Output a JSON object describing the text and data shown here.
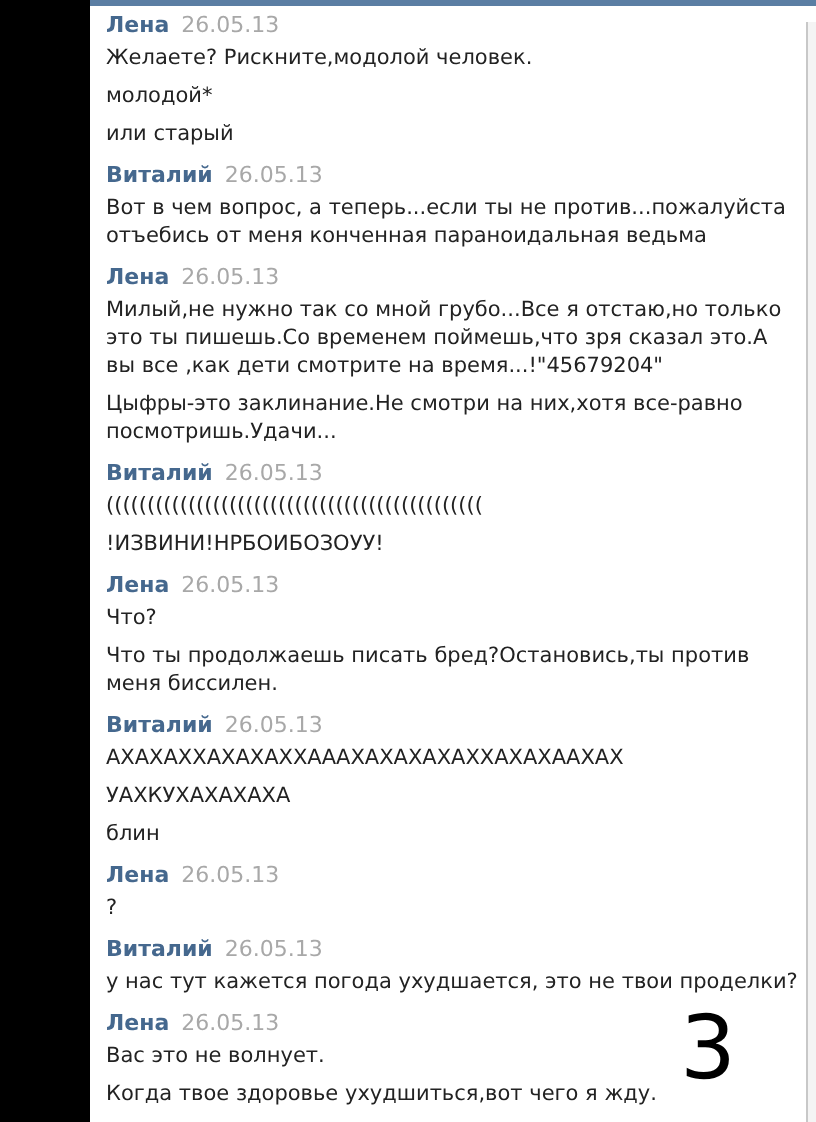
{
  "messages": [
    {
      "author": "Лена",
      "date": "26.05.13",
      "lines": [
        "Желаете? Рискните,модолой человек.",
        "молодой*",
        "или старый"
      ]
    },
    {
      "author": "Виталий",
      "date": "26.05.13",
      "lines": [
        "Вот в чем вопрос, а теперь...если ты не против...пожалуйста отъебись от меня конченная параноидальная ведьма"
      ]
    },
    {
      "author": "Лена",
      "date": "26.05.13",
      "lines": [
        "Милый,не нужно так со мной грубо...Все я отстаю,но только это ты пишешь.Со временем поймешь,что зря сказал это.А вы все ,как дети смотрите на время...!\"45679204\"",
        "Цыфры-это заклинание.Не смотри на них,хотя все-равно посмотришь.Удачи..."
      ]
    },
    {
      "author": "Виталий",
      "date": "26.05.13",
      "lines": [
        "((((((((((((((((((((((((((((((((((((((((((((((",
        "!ИЗВИНИ!НРБОИБОЗОУУ!"
      ]
    },
    {
      "author": "Лена",
      "date": "26.05.13",
      "lines": [
        "Что?",
        "Что ты продолжаешь писать бред?Остановись,ты против меня биссилен."
      ]
    },
    {
      "author": "Виталий",
      "date": "26.05.13",
      "lines": [
        "АХАХАХХАХАХАХХАААХАХАХАХАХХАХАХААХАХ",
        "УАХКУХАХАХАХА",
        "блин"
      ]
    },
    {
      "author": "Лена",
      "date": "26.05.13",
      "lines": [
        "?"
      ]
    },
    {
      "author": "Виталий",
      "date": "26.05.13",
      "lines": [
        "у нас тут кажется погода ухудшается, это не твои проделки?"
      ]
    },
    {
      "author": "Лена",
      "date": "26.05.13",
      "lines": [
        "Вас это не волнует.",
        "Когда твое здоровье ухудшиться,вот чего я жду."
      ]
    }
  ],
  "annotation": "3"
}
